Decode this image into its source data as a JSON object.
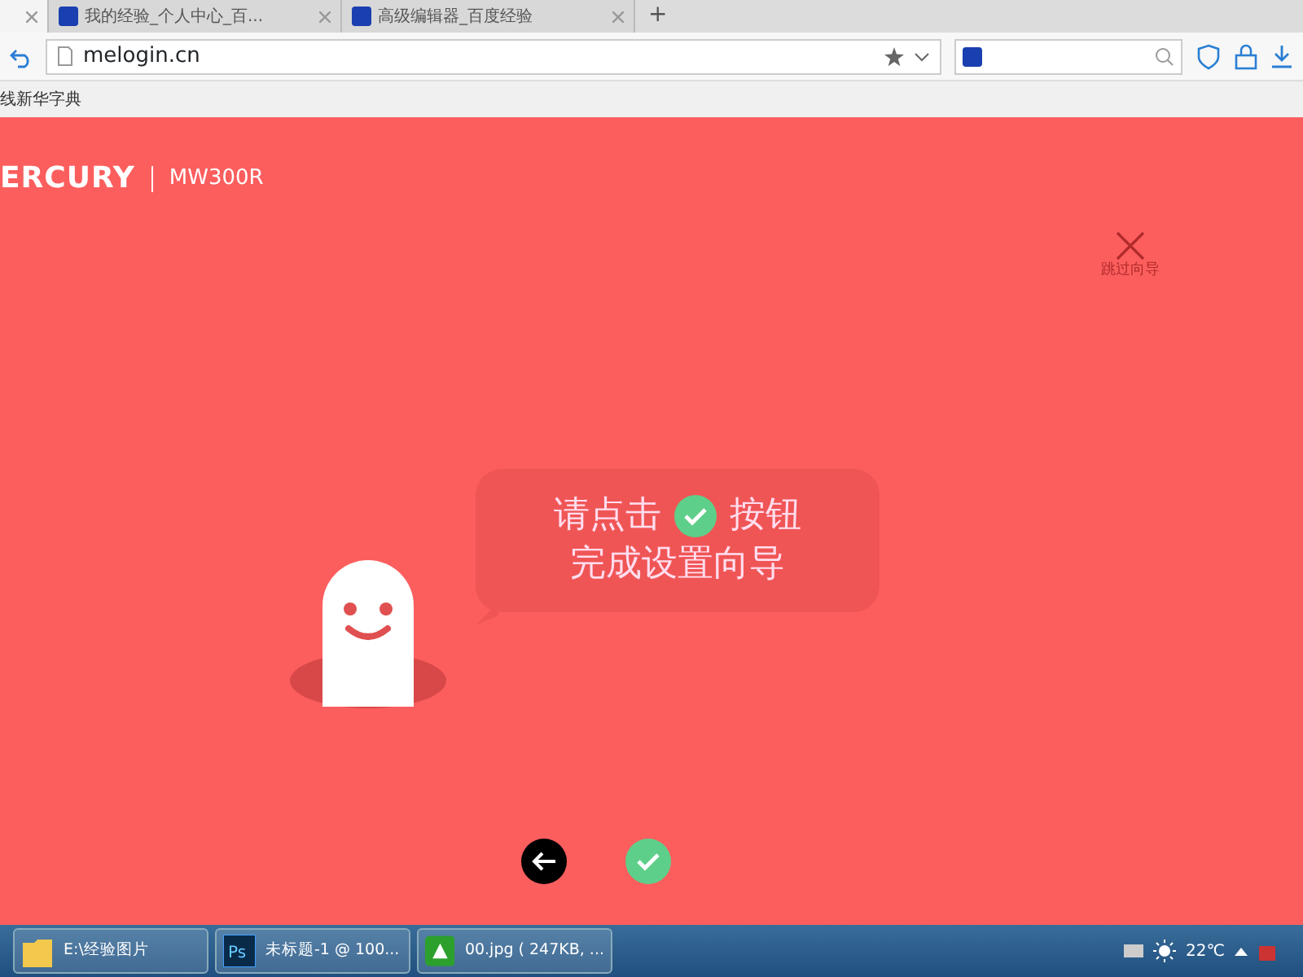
{
  "browser": {
    "tabs": [
      {
        "selected": true
      },
      {
        "label": "我的经验_个人中心_百...",
        "selected": false
      },
      {
        "label": "高级编辑器_百度经验",
        "selected": false
      }
    ],
    "new_tab": "+",
    "address": "melogin.cn",
    "bookmarks": [
      "线新华字典"
    ]
  },
  "page": {
    "logo": "ERCURY",
    "model": "MW300R",
    "skip_label": "跳过向导",
    "bubble": {
      "line_1_before": "请点击",
      "line_1_after": "按钮",
      "line_2": "完成设置向导"
    }
  },
  "taskbar": {
    "items": [
      {
        "label": "E:\\经验图片",
        "kind": "folder"
      },
      {
        "label": "未标题-1 @ 100...",
        "kind": "ps",
        "icon_text": "Ps"
      },
      {
        "label": "00.jpg ( 247KB, ...",
        "kind": "viewer"
      }
    ],
    "temperature": "22℃"
  }
}
